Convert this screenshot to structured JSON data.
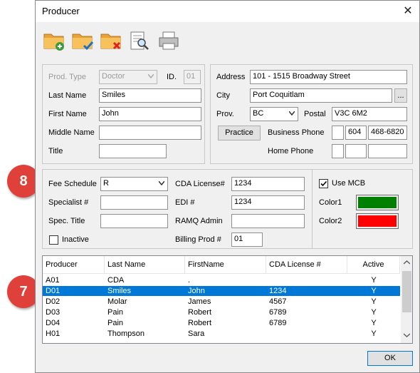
{
  "window": {
    "title": "Producer",
    "close_glyph": "✕"
  },
  "toolbar": {
    "icons": [
      "folder-add-icon",
      "folder-check-icon",
      "folder-delete-icon",
      "search-document-icon",
      "printer-icon"
    ]
  },
  "profile": {
    "prod_type_label": "Prod. Type",
    "prod_type_value": "Doctor",
    "id_label": "ID.",
    "id_value": "01",
    "last_name_label": "Last Name",
    "last_name_value": "Smiles",
    "first_name_label": "First Name",
    "first_name_value": "John",
    "middle_name_label": "Middle Name",
    "middle_name_value": "",
    "title_label": "Title",
    "title_value": ""
  },
  "address": {
    "address_label": "Address",
    "address_value": "101 - 1515 Broadway Street",
    "city_label": "City",
    "city_value": "Port Coquitlam",
    "city_button": "...",
    "prov_label": "Prov.",
    "prov_value": "BC",
    "postal_label": "Postal",
    "postal_value": "V3C 6M2",
    "practice_button": "Practice",
    "business_phone_label": "Business Phone",
    "business_phone": [
      "",
      "604",
      "468-6820"
    ],
    "home_phone_label": "Home Phone",
    "home_phone": [
      "",
      "",
      ""
    ]
  },
  "billing": {
    "fee_schedule_label": "Fee Schedule",
    "fee_schedule_value": "R",
    "specialist_label": "Specialist #",
    "specialist_value": "",
    "spec_title_label": "Spec. Title",
    "spec_title_value": "",
    "inactive_label": "Inactive",
    "inactive_checked": false,
    "cda_license_label": "CDA License#",
    "cda_license_value": "1234",
    "edi_label": "EDI #",
    "edi_value": "1234",
    "ramq_label": "RAMQ Admin",
    "ramq_value": "",
    "billing_prod_label": "Billing Prod #",
    "billing_prod_value": "01"
  },
  "mcb": {
    "use_mcb_label": "Use MCB",
    "use_mcb_checked": true,
    "color1_label": "Color1",
    "color1": "#008000",
    "color2_label": "Color2",
    "color2": "#ff0000"
  },
  "grid": {
    "columns": [
      "Producer",
      "Last Name",
      "FirstName",
      "CDA License #",
      "Active"
    ],
    "rows": [
      [
        "A01",
        "CDA",
        ".",
        "",
        "Y"
      ],
      [
        "D01",
        "Smiles",
        "John",
        "1234",
        "Y"
      ],
      [
        "D02",
        "Molar",
        "James",
        "4567",
        "Y"
      ],
      [
        "D03",
        "Pain",
        "Robert",
        "6789",
        "Y"
      ],
      [
        "D04",
        "Pain",
        "Robert",
        "6789",
        "Y"
      ],
      [
        "H01",
        "Thompson",
        "Sara",
        "",
        "Y"
      ]
    ],
    "selected_row": 1
  },
  "ok_button": "OK",
  "callouts": {
    "fee_schedule": "8",
    "grid_row": "7"
  },
  "colors": {
    "accent": "#0078d7",
    "callout": "#e0403a"
  }
}
